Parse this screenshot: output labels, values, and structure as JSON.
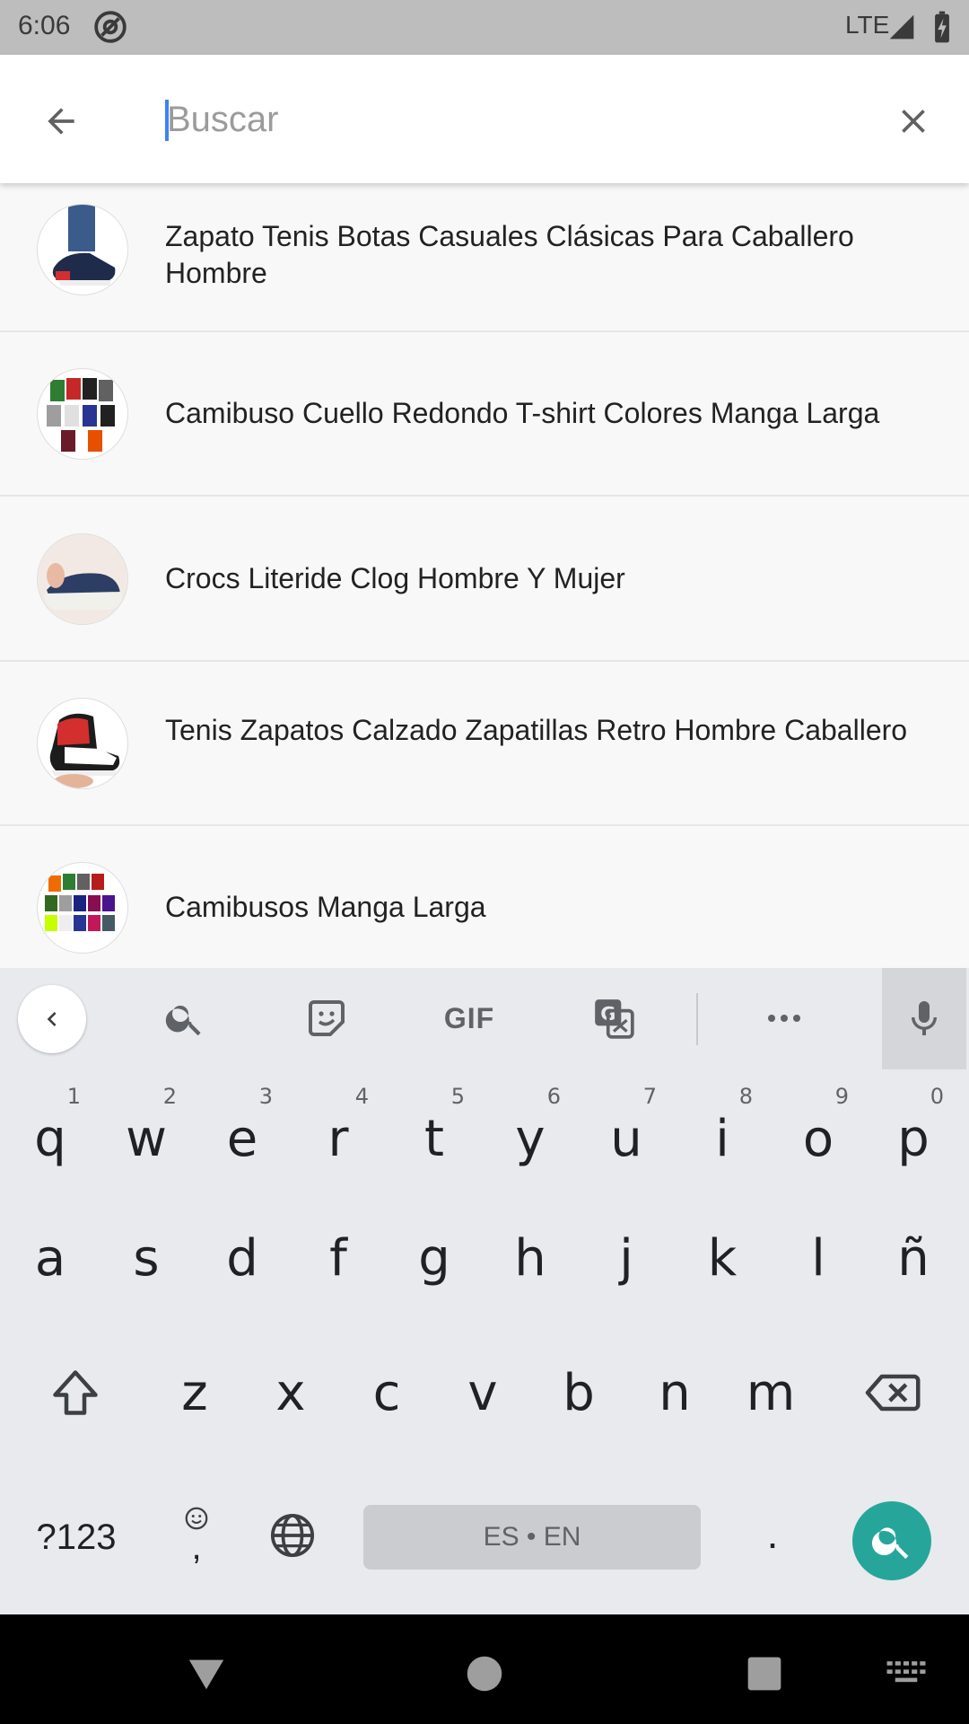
{
  "status_bar": {
    "time": "6:06",
    "network": "LTE",
    "icons": [
      "at-sign-icon",
      "signal-icon",
      "battery-charging-icon"
    ]
  },
  "search": {
    "placeholder": "Buscar",
    "back_icon": "arrow-left-icon",
    "clear_icon": "close-icon"
  },
  "results": [
    {
      "label": "Zapato Tenis Botas Casuales Clásicas Para Caballero Hombre",
      "thumb": "sneaker-thumbnail"
    },
    {
      "label": "Camibuso Cuello Redondo T-shirt Colores Manga Larga",
      "thumb": "shirts-grid-thumbnail"
    },
    {
      "label": "Crocs Literide Clog Hombre Y Mujer",
      "thumb": "clog-thumbnail"
    },
    {
      "label": "Tenis Zapatos Calzado Zapatillas  Retro Hombre Caballero",
      "thumb": "retro-sneaker-thumbnail"
    },
    {
      "label": "Camibusos Manga Larga",
      "thumb": "shirts-grid-thumbnail"
    }
  ],
  "keyboard": {
    "toolbar": [
      "back-icon",
      "search-icon",
      "sticker-icon",
      "GIF",
      "translate-icon",
      "more-icon",
      "mic-icon"
    ],
    "gif_label": "GIF",
    "row1": [
      {
        "k": "q",
        "h": "1"
      },
      {
        "k": "w",
        "h": "2"
      },
      {
        "k": "e",
        "h": "3"
      },
      {
        "k": "r",
        "h": "4"
      },
      {
        "k": "t",
        "h": "5"
      },
      {
        "k": "y",
        "h": "6"
      },
      {
        "k": "u",
        "h": "7"
      },
      {
        "k": "i",
        "h": "8"
      },
      {
        "k": "o",
        "h": "9"
      },
      {
        "k": "p",
        "h": "0"
      }
    ],
    "row2": [
      "a",
      "s",
      "d",
      "f",
      "g",
      "h",
      "j",
      "k",
      "l",
      "ñ"
    ],
    "row3": [
      "z",
      "x",
      "c",
      "v",
      "b",
      "n",
      "m"
    ],
    "symbols_label": "?123",
    "emoji_comma": ",",
    "space_label": "ES • EN",
    "period_label": ".",
    "action_color": "#26a69a"
  },
  "nav_bar": [
    "back-triangle-icon",
    "home-circle-icon",
    "recents-square-icon",
    "keyboard-icon"
  ]
}
